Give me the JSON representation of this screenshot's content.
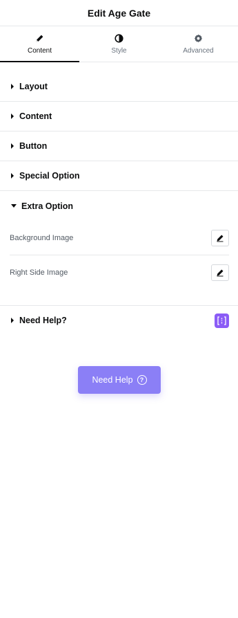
{
  "header": {
    "title": "Edit Age Gate"
  },
  "tabs": [
    {
      "label": "Content",
      "icon": "pencil-icon",
      "active": true
    },
    {
      "label": "Style",
      "icon": "contrast-icon",
      "active": false
    },
    {
      "label": "Advanced",
      "icon": "gear-icon",
      "active": false
    }
  ],
  "sections": {
    "layout": "Layout",
    "content": "Content",
    "button": "Button",
    "special": "Special Option",
    "extra": "Extra Option"
  },
  "extra_controls": {
    "background_image": "Background Image",
    "right_side_image": "Right Side Image"
  },
  "help": {
    "title": "Need Help?",
    "button_label": "Need Help",
    "button_icon": "question-circle-icon",
    "accent": "#8b5cf6",
    "button_color": "#8b7ff6"
  }
}
